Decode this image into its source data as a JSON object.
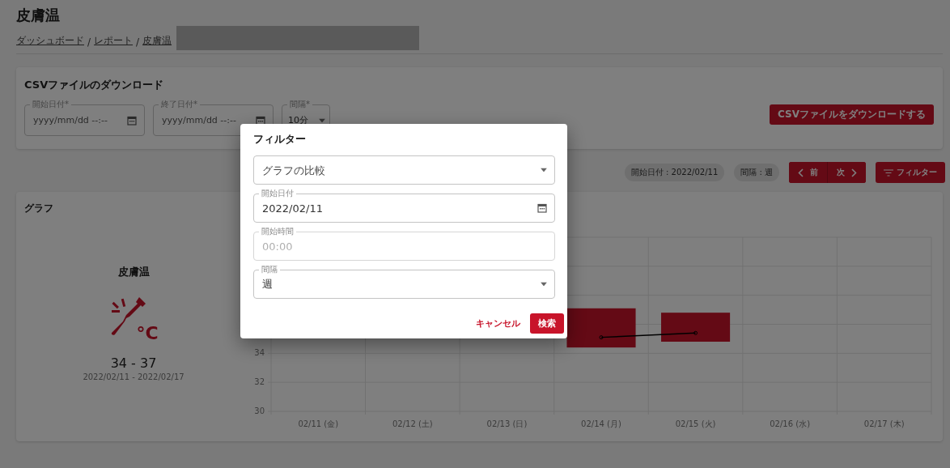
{
  "page": {
    "title": "皮膚温",
    "breadcrumb": [
      {
        "kind": "link",
        "label": "ダッシュボード"
      },
      {
        "kind": "separator",
        "label": "/"
      },
      {
        "kind": "link",
        "label": "レポート"
      },
      {
        "kind": "separator",
        "label": "/"
      },
      {
        "kind": "link",
        "label": "皮膚温"
      }
    ],
    "redacted": true
  },
  "csv_download": {
    "title": "CSVファイルのダウンロード",
    "fields": [
      {
        "kind": "datetime",
        "label": "開始日付*",
        "placeholder": "yyyy/mm/dd --:--"
      },
      {
        "kind": "datetime",
        "label": "終了日付*",
        "placeholder": "yyyy/mm/dd --:--"
      },
      {
        "kind": "select",
        "label": "間隔*",
        "value": "10分"
      }
    ],
    "button": "CSVファイルをダウンロードする"
  },
  "toolbar": {
    "chips": [
      "開始日付 : 2022/02/11",
      "間隔 : 週"
    ],
    "prev": "前",
    "next": "次",
    "filter": "フィルター"
  },
  "graph": {
    "title": "グラフ",
    "summary": {
      "name": "皮膚温",
      "unit": "°C",
      "range": "34 - 37",
      "period": "2022/02/11 - 2022/02/17"
    },
    "chart": {
      "x_labels": [
        "02/11 (金)",
        "02/12 (土)",
        "02/13 (日)",
        "02/14 (月)",
        "02/15 (火)",
        "02/16 (水)",
        "02/17 (木)"
      ],
      "y_labels": [
        "34",
        "32",
        "30"
      ]
    }
  },
  "modal": {
    "title": "フィルター",
    "fields": [
      {
        "kind": "select",
        "placeholder": "グラフの比較",
        "disabled": false
      },
      {
        "kind": "date",
        "label": "開始日付",
        "value": "2022/02/11",
        "disabled": false
      },
      {
        "kind": "text",
        "label": "開始時間",
        "value": "00:00",
        "disabled": true
      },
      {
        "kind": "select",
        "label": "間隔",
        "value": "週",
        "disabled": false
      }
    ],
    "cancel": "キャンセル",
    "submit": "検索"
  }
}
